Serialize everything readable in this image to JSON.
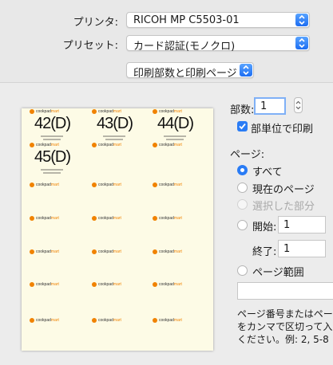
{
  "header": {
    "printer_label": "プリンタ:",
    "printer_value": "RICOH MP C5503-01",
    "preset_label": "プリセット:",
    "preset_value": "カード認証(モノクロ)",
    "section_value": "印刷部数と印刷ページ"
  },
  "preview": {
    "logo_main": "cookpad",
    "logo_accent": "mart",
    "labels": [
      "42(D)",
      "43(D)",
      "44(D)",
      "45(D)"
    ]
  },
  "options": {
    "copies_label": "部数:",
    "copies_value": "1",
    "collate_label": "部単位で印刷",
    "collate_checked": true,
    "pages_label": "ページ:",
    "all_label": "すべて",
    "current_label": "現在のページ",
    "selection_label": "選択した部分",
    "from_label": "開始:",
    "from_value": "1",
    "to_label": "終了:",
    "to_value": "1",
    "range_label": "ページ範囲",
    "range_value": "",
    "note_line1": "ページ番号またはペー",
    "note_line2": "をカンマで区切って入",
    "note_line3": "ください。例: 2, 5-8"
  },
  "colors": {
    "accent": "#2a7cf5",
    "logo_orange": "#f08200",
    "paper": "#fdfbe6"
  }
}
